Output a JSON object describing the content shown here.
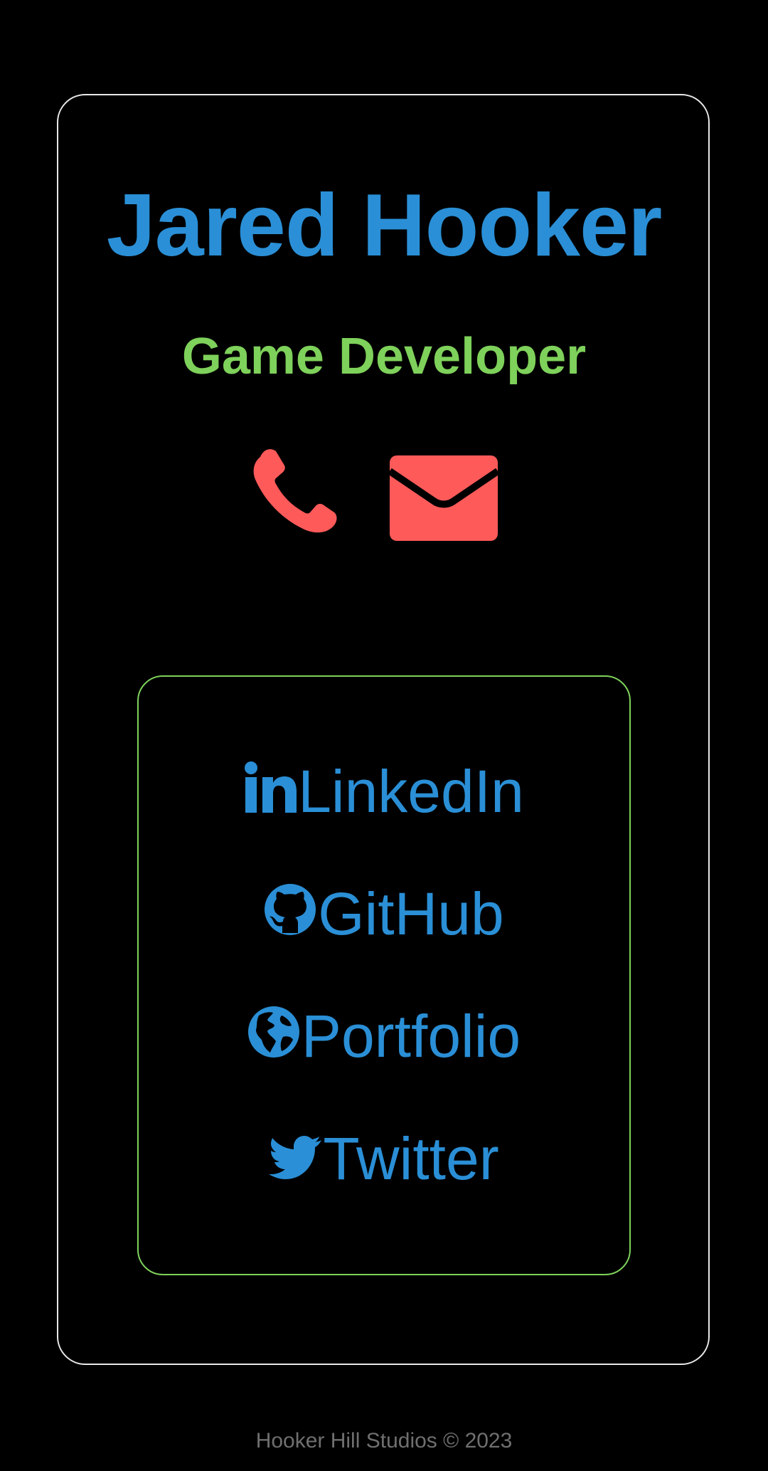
{
  "profile": {
    "name": "Jared Hooker",
    "role": "Game Developer"
  },
  "contacts": {
    "phone_icon": "phone-icon",
    "email_icon": "envelope-icon"
  },
  "links": [
    {
      "label": "LinkedIn",
      "icon": "linkedin-icon"
    },
    {
      "label": "GitHub",
      "icon": "github-icon"
    },
    {
      "label": "Portfolio",
      "icon": "globe-icon"
    },
    {
      "label": "Twitter",
      "icon": "twitter-icon"
    }
  ],
  "footer": {
    "text": "Hooker Hill Studios © 2023"
  },
  "colors": {
    "background": "#000000",
    "name": "#2a8fd6",
    "role": "#7ed15a",
    "contact_icons": "#ff5a5a",
    "links": "#2a8fd6",
    "card_border": "#e8e8e8",
    "links_border": "#7ed15a",
    "footer": "#6f6f6f"
  }
}
